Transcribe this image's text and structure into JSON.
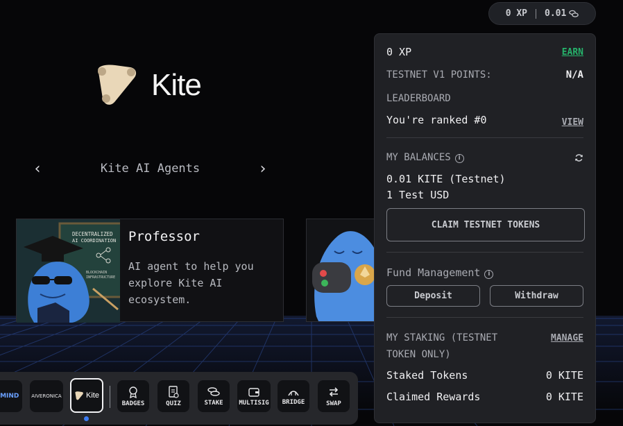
{
  "topbar": {
    "xp": "0 XP",
    "balance": "0.01"
  },
  "logo": {
    "word": "Kite"
  },
  "carousel": {
    "title": "Kite AI Agents",
    "prev": "‹",
    "next": "›"
  },
  "card": {
    "title": "Professor",
    "description": "AI agent to help you explore Kite AI ecosystem.",
    "board_lines": [
      "DECENTRALIZED",
      "AI COORDINATION",
      "BLOCKCHAIN",
      "INFRASTRUCTURE"
    ]
  },
  "dock": {
    "items": [
      {
        "name": "ITMIND",
        "label": ""
      },
      {
        "name": "AIVERONICA",
        "label": ""
      },
      {
        "name": "Kite",
        "label": ""
      },
      {
        "name": "badges",
        "label": "BADGES"
      },
      {
        "name": "quiz",
        "label": "QUIZ"
      },
      {
        "name": "stake",
        "label": "STAKE"
      },
      {
        "name": "multisig",
        "label": "MULTISIG"
      },
      {
        "name": "bridge",
        "label": "BRIDGE"
      },
      {
        "name": "swap",
        "label": "SWAP"
      }
    ],
    "thumb_texts": {
      "itmind": "ITMIND",
      "aiveronica": "AIVERONICA",
      "kite": "Kite"
    }
  },
  "panel": {
    "xp": "0 XP",
    "earn": "EARN",
    "testnet_points_label": "TESTNET V1 POINTS:",
    "testnet_points_value": "N/A",
    "leaderboard_label": "LEADERBOARD",
    "ranked": "You're ranked #0",
    "view": "VIEW",
    "balances_label": "MY BALANCES",
    "balance_kite": "0.01 KITE (Testnet)",
    "balance_usd": "1 Test USD",
    "claim_button": "CLAIM TESTNET TOKENS",
    "fund_label": "Fund Management",
    "deposit": "Deposit",
    "withdraw": "Withdraw",
    "staking_label": "MY STAKING (TESTNET TOKEN ONLY)",
    "manage": "MANAGE",
    "staked_label": "Staked Tokens",
    "staked_value": "0 KITE",
    "claimed_label": "Claimed Rewards",
    "claimed_value": "0 KITE"
  },
  "colors": {
    "accent_green": "#26b36b",
    "dot_blue": "#3d7cf2",
    "panel_bg": "#202125"
  }
}
